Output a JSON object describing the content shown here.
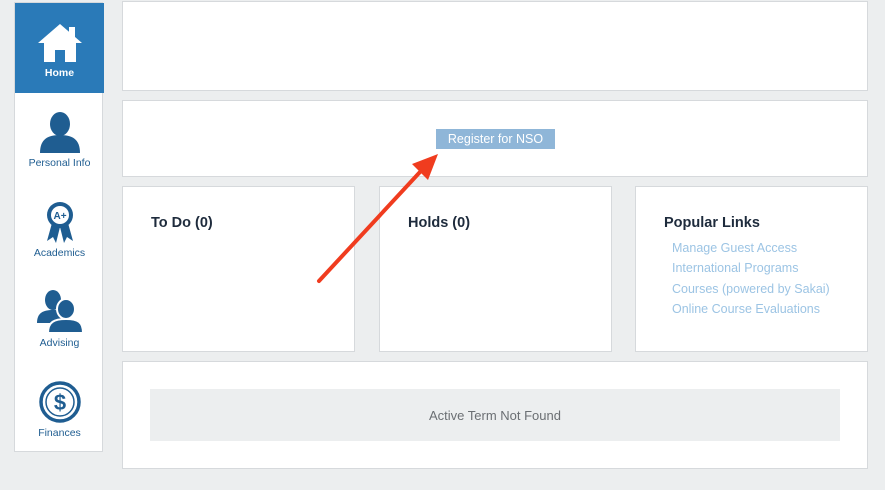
{
  "sidebar": {
    "items": [
      {
        "label": "Home",
        "icon": "home-icon",
        "active": true
      },
      {
        "label": "Personal Info",
        "icon": "person-icon",
        "active": false
      },
      {
        "label": "Academics",
        "icon": "award-ribbon-icon",
        "active": false
      },
      {
        "label": "Advising",
        "icon": "people-icon",
        "active": false
      },
      {
        "label": "Finances",
        "icon": "dollar-icon",
        "active": false
      }
    ]
  },
  "banner": {
    "register_nso_label": "Register for NSO"
  },
  "cards": {
    "todo": {
      "title": "To Do (0)"
    },
    "holds": {
      "title": "Holds (0)"
    },
    "popular_links": {
      "title": "Popular Links",
      "links": [
        "Manage Guest Access",
        "International Programs",
        "Courses (powered by Sakai)",
        "Online Course Evaluations"
      ]
    }
  },
  "term": {
    "message": "Active Term Not Found"
  },
  "colors": {
    "accent": "#2a7ab8",
    "icon_blue": "#1f5d91",
    "button_bg": "#8fb6d8",
    "link": "#9cc4e4",
    "annotation_arrow": "#f03c1f"
  }
}
